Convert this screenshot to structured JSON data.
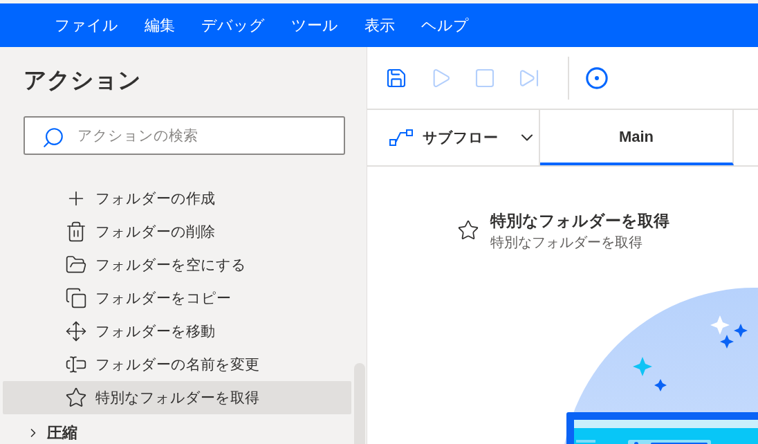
{
  "menu": [
    {
      "label": "ファイル"
    },
    {
      "label": "編集"
    },
    {
      "label": "デバッグ"
    },
    {
      "label": "ツール"
    },
    {
      "label": "表示"
    },
    {
      "label": "ヘルプ"
    }
  ],
  "actions_panel": {
    "title": "アクション",
    "search": {
      "placeholder": "アクションの検索"
    },
    "items": [
      {
        "kind": "plus",
        "label": "フォルダーの作成",
        "selected": false
      },
      {
        "kind": "trash",
        "label": "フォルダーの削除",
        "selected": false
      },
      {
        "kind": "folder",
        "label": "フォルダーを空にする",
        "selected": false
      },
      {
        "kind": "copy",
        "label": "フォルダーをコピー",
        "selected": false
      },
      {
        "kind": "move",
        "label": "フォルダーを移動",
        "selected": false
      },
      {
        "kind": "rename",
        "label": "フォルダーの名前を変更",
        "selected": false
      },
      {
        "kind": "star",
        "label": "特別なフォルダーを取得",
        "selected": true
      }
    ],
    "category": {
      "label": "圧縮",
      "expanded": false
    }
  },
  "toolbar": [
    {
      "kind": "save",
      "disabled": false
    },
    {
      "kind": "run",
      "disabled": true
    },
    {
      "kind": "stop",
      "disabled": true
    },
    {
      "kind": "step",
      "disabled": true
    },
    {
      "kind": "record",
      "disabled": false
    }
  ],
  "subflow": {
    "label": "サブフロー"
  },
  "tabs": [
    {
      "label": "Main",
      "selected": true
    }
  ],
  "content": {
    "title": "特別なフォルダーを取得",
    "subtitle": "特別なフォルダーを取得"
  }
}
